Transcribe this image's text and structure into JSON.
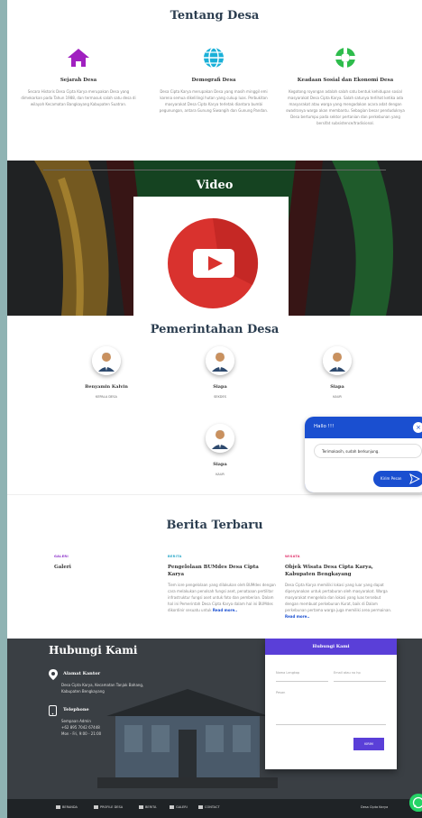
{
  "tentang": {
    "title": "Tentang Desa",
    "cols": [
      {
        "icon": "home-icon",
        "heading": "Sejarah Desa",
        "text": "Secara Historis Desa Cipta Karya merupakan Desa yang dimekarkan pada Tahun 1988, dan termasuk salah satu desa di wilayah Kecamatan Bangkayang Kabupaten Suatran."
      },
      {
        "icon": "globe-icon",
        "heading": "Demografi Desa",
        "text": "Desa Cipta Karya merupakan Desa yang masih minggil emi karena semua dikelilingi hutan yang cukup luas. Perbukitan masyarakat Desa Cipta Karya terletak diantara bumbi pegunungan, antara Gunung Siwangih dan Gunung Pandan."
      },
      {
        "icon": "lifebuoy-icon",
        "heading": "Keadaan Sosial dan Ekonomi Desa",
        "text": "Kegotong royongan adalah salah satu bentuk kehidupan sosial masyarakat Desa Cipta Karya. Salah satunya terlihat ketika ada masyarakat atau warga yang mengadakan acara adat dengan swadranya warga akan membantu. Sebagian besar penduduknya Desa bertumpu pada sektor pertanian dan perkebunan yang bersifat subsistence/tradisional."
      }
    ]
  },
  "video": {
    "title": "Video"
  },
  "pemerintahan": {
    "title": "Pemerintahan Desa",
    "people": [
      {
        "name": "Benyamin Kalvin",
        "role": "KEPALA DESA"
      },
      {
        "name": "Siapa",
        "role": "SEKDES"
      },
      {
        "name": "Siapa",
        "role": "KAUR"
      },
      {
        "name": "Siapa",
        "role": "KAUR"
      }
    ]
  },
  "chat": {
    "header": "Hallo !!!",
    "message": "Terimakasih, sudah berkunjung.",
    "send_label": "Kirim Pesan"
  },
  "berita": {
    "title": "Berita Terbaru",
    "items": [
      {
        "category": "GALERI",
        "category_color": "#8b2fc9",
        "heading": "Galeri",
        "text": "",
        "more": ""
      },
      {
        "category": "BERITA",
        "category_color": "#2aa8c8",
        "heading": "Pengelolaan BUMdes Desa Cipta Karya",
        "text": "Tiem iore pengelolaan yang dilakukan oleh BUMdes dengan cara melakukan penolsah fungsi aset, penataaan pertilitar infrastruktur fungsi aset untuk foto dan pemberian. Dalam hal ini Pemerintah Desa Cipta Karya dalam hal ini BUMdes dikordinir sesuatu untuk",
        "more": "Read more.."
      },
      {
        "category": "WISATA",
        "category_color": "#e0306a",
        "heading": "Objek Wisata Desa Cipta Karya, Kabupaten Bengkayang",
        "text": "Desa Cipta Karya memiliki lokasi yang luar yang dapat diperyanakan untuk pertaburan oleh masyarakat. Warga masyarakat mengelola dan lokasi yang luas tersebut dengan membuat perkebunan Kurat, baik di Dalam perkebunan pertama warga juga memiliki area permainan.",
        "more": "Read more.."
      }
    ]
  },
  "hubungi": {
    "title": "Hubungi Kami",
    "alamat_heading": "Alamat Kantor",
    "alamat_text": "Desa Cipta Karya, Kecamatan Tanjak Bahang, Kabupaten Bengkayang",
    "telepon_heading": "Telephone",
    "telepon_lines": [
      "Sempaan Admin",
      "+62 895 7042 67448",
      "Mon - Fri, 9:00 - 21:00"
    ],
    "form_title": "Hubungi Kami",
    "nama_placeholder": "Nama Lengkap",
    "email_placeholder": "Email atau no hp",
    "pesan_placeholder": "Pesan",
    "submit_label": "KIRIM"
  },
  "footer": {
    "nav": [
      "BERANDA",
      "PROFILE DESA",
      "BERITA",
      "GALERI",
      "CONTACT"
    ],
    "brand": "Desa Cipta Karya"
  },
  "colors": {
    "accent": "#5a3fd8",
    "chat": "#1a4fd0",
    "whatsapp": "#25d366"
  }
}
